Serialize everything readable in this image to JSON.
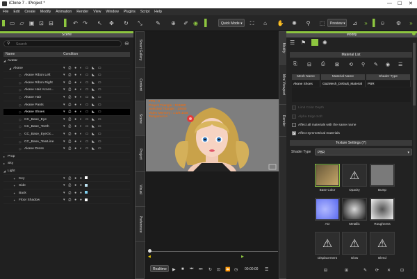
{
  "window": {
    "title": "iClone 7 - \\Project *",
    "minimize": "—",
    "maximize": "☐",
    "close": "✕"
  },
  "menu": [
    "File",
    "Edit",
    "Create",
    "Modify",
    "Animation",
    "Render",
    "View",
    "Window",
    "Plugins",
    "Script",
    "Help"
  ],
  "toolbar": {
    "mode": "Quick Mode",
    "preview": "Preview"
  },
  "scene": {
    "title": "Scene",
    "search_placeholder": "Search",
    "col_name": "Name",
    "col_condition": "Condition",
    "rows": [
      {
        "label": "Avatar",
        "indent": 4,
        "arrow": "◢",
        "cond": ""
      },
      {
        "label": "Akane",
        "indent": 12,
        "arrow": "◢",
        "cond": "▾ ⎙ ● ◐ ▭ ◣ ▭"
      },
      {
        "label": "Akane Ribon Left",
        "indent": 28,
        "arrow": "",
        "cond": "▾ ⎙ ● ◐ ▭ ◣ ▭"
      },
      {
        "label": "Akane Ribon Right",
        "indent": 28,
        "arrow": "",
        "cond": "▾ ⎙ ● ◐ ▭ ◣ ▭"
      },
      {
        "label": "Akane Hair Acces...",
        "indent": 28,
        "arrow": "",
        "cond": "▾ ⎙ ● ◐ ▭ ◣ ▭"
      },
      {
        "label": "Akane Hair",
        "indent": 28,
        "arrow": "",
        "cond": "▾ ⎙ ● ◐ ▭ ◣ ▭"
      },
      {
        "label": "Akane Pants",
        "indent": 28,
        "arrow": "",
        "cond": "▾ ⎙ ● ◐ ▭ ◣ ▭"
      },
      {
        "label": "Akane Shoes",
        "indent": 28,
        "arrow": "",
        "cond": "▾ ⎙ ● ◐ ▭ ◣ ▭"
      },
      {
        "label": "CC_Base_Eye",
        "indent": 28,
        "arrow": "",
        "cond": "▾ ⎙ ● ◐ ▭ ◣ ▭"
      },
      {
        "label": "CC_Base_Teeth",
        "indent": 28,
        "arrow": "",
        "cond": "▾ ⎙ ● ◐ ▭ ◣ ▭"
      },
      {
        "label": "CC_Base_EyeOc...",
        "indent": 28,
        "arrow": "",
        "cond": "▾ ⎙ ● ◐ ▭ ◣ ▭"
      },
      {
        "label": "CC_Base_TearLine",
        "indent": 28,
        "arrow": "",
        "cond": "▾ ⎙ ● ◐ ▭ ◣ ▭"
      },
      {
        "label": "Akane Dress",
        "indent": 28,
        "arrow": "",
        "cond": "▾ ⎙ ● ◐ ▭ ◣ ▭"
      },
      {
        "label": "Prop",
        "indent": 4,
        "arrow": "▸",
        "cond": ""
      },
      {
        "label": "Sky",
        "indent": 4,
        "arrow": "▸",
        "cond": ""
      },
      {
        "label": "Light",
        "indent": 4,
        "arrow": "◢",
        "cond": ""
      },
      {
        "label": "Key",
        "indent": 20,
        "arrow": "",
        "cond": "▾ ⎙ ● ●",
        "swatch": "#ffffff"
      },
      {
        "label": "Side",
        "indent": 20,
        "arrow": "",
        "cond": "▾ ⎙ ● ●",
        "swatch": "#bfe6f5"
      },
      {
        "label": "Back",
        "indent": 20,
        "arrow": "",
        "cond": "▾ ⎙ ● ●",
        "swatch": "#7fd0f0"
      },
      {
        "label": "Floor Shadow",
        "indent": 20,
        "arrow": "",
        "cond": "▾ ⎙ ● ●",
        "swatch": "#ffffff"
      }
    ],
    "selected": "Akane Shoes"
  },
  "left_tabs": [
    "Smart Gallery",
    "Content",
    "Scene",
    "Project",
    "Visual",
    "Preference"
  ],
  "viewport": {
    "stats": [
      "FPS : 0",
      "Project Triangle : 153660",
      "Selected Triangle : 14650",
      "Video Memory : 1.5/8.1GB",
      "Temporal AA"
    ]
  },
  "timeline": {
    "realtime": "Realtime",
    "time": "00:00:00"
  },
  "modify": {
    "title": "Modify",
    "side_tabs": [
      "Modify",
      "Mini Viewport",
      "Render"
    ],
    "material_list": "Material List",
    "table_headers": [
      "Mesh Name",
      "Material Name",
      "Shader Type"
    ],
    "table_row": [
      "Akane Shoes",
      "Ga2Mesh_Default_Material",
      "PBR"
    ],
    "checks": [
      {
        "label": "Limit Color Depth",
        "on": false,
        "dim": true
      },
      {
        "label": "Alpha Edge Soft",
        "on": false,
        "dim": true
      },
      {
        "label": "Affect all materials with the same name",
        "on": false,
        "dim": false
      },
      {
        "label": "Affect symmetrical materials",
        "on": true,
        "dim": false
      }
    ],
    "texture_settings": "Texture Settings  (Y)",
    "shader_type_label": "Shader Type",
    "shader_type_value": "PBR",
    "textures": [
      "Base Color",
      "Opacity",
      "Bump",
      "AO",
      "Metallic",
      "Roughness",
      "Displacement",
      "Glow",
      "Blend"
    ]
  },
  "colors": {
    "accent": "#8dc63f",
    "selection": "#000000",
    "stats": "#ff6a00"
  }
}
